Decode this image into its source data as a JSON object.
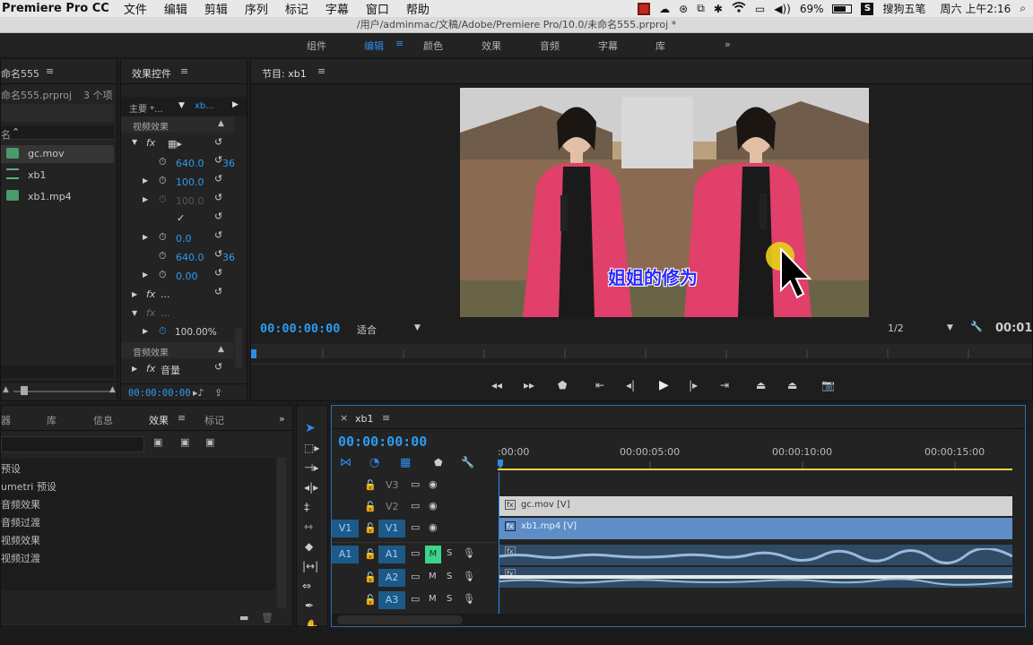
{
  "menubar": {
    "app": "Premiere Pro CC",
    "items": [
      "文件",
      "编辑",
      "剪辑",
      "序列",
      "标记",
      "字幕",
      "窗口",
      "帮助"
    ],
    "battery": "69%",
    "ime": "搜狗五笔",
    "clock": "周六 上午2:16"
  },
  "window_title": "/用户/adminmac/文稿/Adobe/Premiere Pro/10.0/未命名555.prproj *",
  "workspaces": [
    "组件",
    "编辑",
    "颜色",
    "效果",
    "音频",
    "字幕",
    "库"
  ],
  "workspace_active": "编辑",
  "workspace_more": "»",
  "project": {
    "title": "命名555",
    "file": "命名555.prproj",
    "count": "3 个项",
    "header": "名",
    "items": [
      "gc.mov",
      "xb1",
      "xb1.mp4"
    ]
  },
  "effect_controls": {
    "title": "效果控件",
    "master": "主要 *...",
    "seq": "xb...",
    "video_section": "视频效果",
    "audio_section": "音频效果",
    "fx": "fx",
    "vals": [
      "640.0",
      "100.0",
      "100.0",
      "0.0",
      "640.0",
      "0.00"
    ],
    "val_suffix": "36",
    "check": "✓",
    "fx_dots": "...",
    "opacity": "100.00%",
    "audio_label": "音量",
    "timecode": "00:00:00:00"
  },
  "program": {
    "title": "节目: xb1",
    "timecode": "00:00:00:00",
    "fit": "适合",
    "resolution": "1/2",
    "end_tc": "00:01:",
    "subtitle": "姐姐的修为"
  },
  "effects_panel": {
    "tabs": [
      "器",
      "库",
      "信息",
      "效果",
      "标记"
    ],
    "active_tab": "效果",
    "more": "»",
    "items": [
      "预设",
      "umetri 预设",
      "音频效果",
      "音频过渡",
      "视频效果",
      "视频过渡"
    ]
  },
  "timeline": {
    "close": "×",
    "title": "xb1",
    "timecode": "00:00:00:00",
    "ruler": [
      ":00:00",
      "00:00:05:00",
      "00:00:10:00",
      "00:00:15:00"
    ],
    "video_tracks": [
      "V3",
      "V2",
      "V1"
    ],
    "audio_tracks": [
      "A1",
      "A2",
      "A3"
    ],
    "source_v": "V1",
    "source_a": "A1",
    "m": "M",
    "s": "S",
    "clip_v2": "gc.mov [V]",
    "clip_v1": "xb1.mp4 [V]",
    "fx_badge": "fx"
  },
  "colors": {
    "accent": "#2d8ceb",
    "timecode": "#2d9bf0",
    "track_blue": "#1d5a87",
    "clip_v1": "#5f8ec7",
    "clip_v2": "#d2d2d2",
    "audio_clip": "#4a6a8c",
    "mute_green": "#3bd48b"
  }
}
